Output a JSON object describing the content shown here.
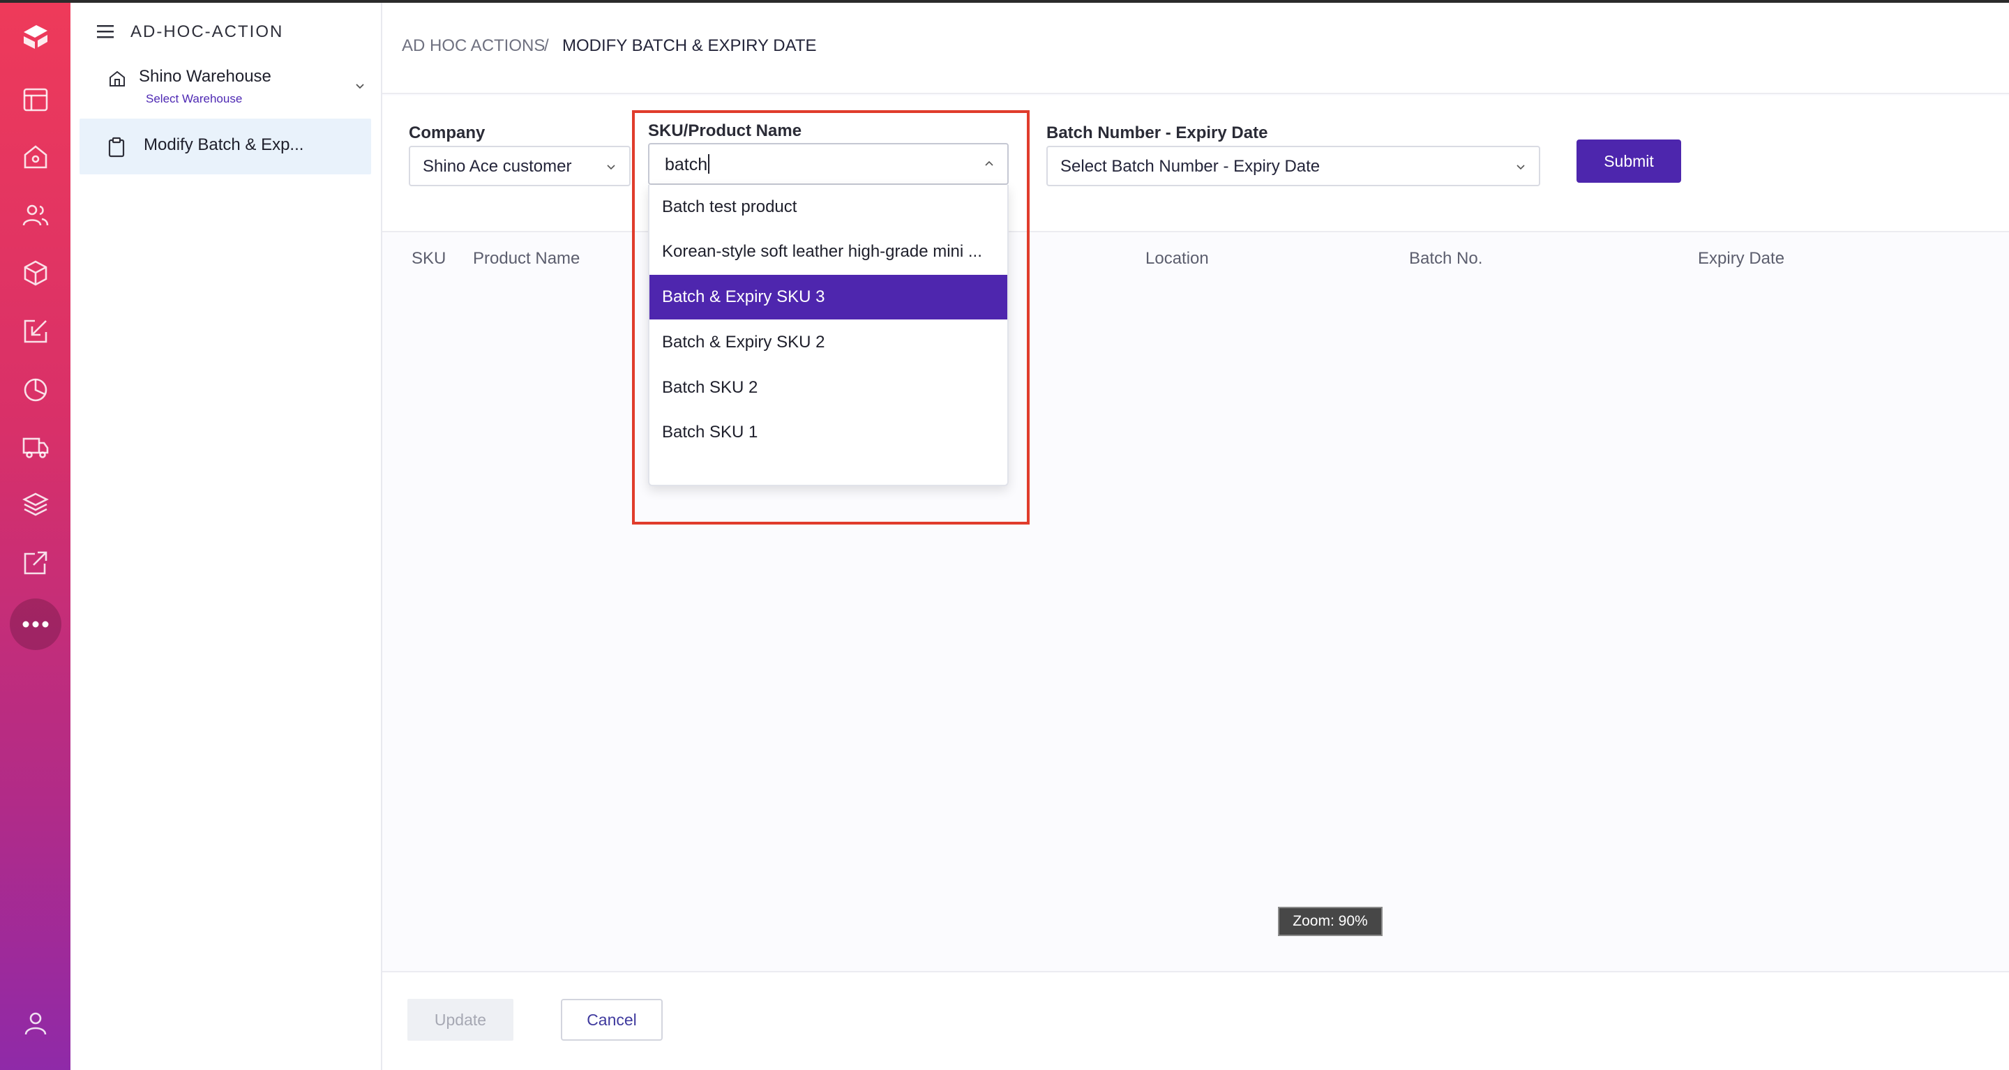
{
  "app": {
    "section_title": "AD-HOC-ACTION",
    "warehouse_name": "Shino Warehouse",
    "warehouse_hint": "Select Warehouse",
    "menu_item_label": "Modify Batch & Exp..."
  },
  "breadcrumb": {
    "parent": "AD HOC ACTIONS",
    "separator": "/",
    "current": "MODIFY BATCH & EXPIRY DATE"
  },
  "form": {
    "company_label": "Company",
    "company_value": "Shino Ace customer",
    "sku_label": "SKU/Product Name",
    "sku_value": "batch",
    "batch_label": "Batch Number - Expiry Date",
    "batch_placeholder": "Select Batch Number - Expiry Date",
    "submit_label": "Submit"
  },
  "dropdown": {
    "options": [
      "Batch test product",
      "Korean-style soft leather high-grade mini ...",
      "Batch & Expiry SKU 3",
      "Batch & Expiry SKU 2",
      "Batch SKU 2",
      "Batch SKU 1"
    ],
    "active_option": "Batch & Expiry SKU 3"
  },
  "table": {
    "columns": [
      "SKU",
      "Product Name",
      "Location",
      "Batch No.",
      "Expiry Date"
    ]
  },
  "footer": {
    "update_label": "Update",
    "cancel_label": "Cancel"
  },
  "zoom_label": "Zoom: 90%",
  "colors": {
    "brand_purple": "#4d26ad",
    "rail_top": "#ee3a5a",
    "rail_bottom": "#8f2aa8",
    "highlight_red": "#e03c2c",
    "selected_menu_bg": "#e9f2fb"
  },
  "icons": {
    "rail": [
      "logo-icon",
      "layout-icon",
      "home-icon",
      "users-icon",
      "box-icon",
      "inbound-icon",
      "reports-icon",
      "truck-icon",
      "layers-icon",
      "external-link-icon",
      "more-icon",
      "user-icon"
    ]
  }
}
